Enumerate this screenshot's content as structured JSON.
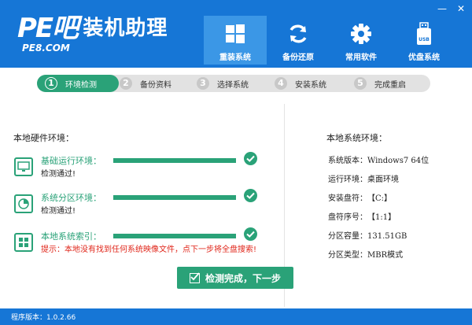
{
  "header": {
    "logo_mark": "PE吧",
    "logo_title": "装机助理",
    "logo_site": "PE8.COM",
    "window_controls": [
      "—",
      "✕"
    ],
    "nav": [
      {
        "label": "重装系统",
        "icon": "windows-icon",
        "active": true
      },
      {
        "label": "备份还原",
        "icon": "refresh-icon",
        "active": false
      },
      {
        "label": "常用软件",
        "icon": "gear-icon",
        "active": false
      },
      {
        "label": "优盘系统",
        "icon": "usb-drive-icon",
        "active": false
      },
      {
        "label": "USB",
        "icon": "usb-text",
        "active": false
      }
    ]
  },
  "steps": [
    {
      "num": "1",
      "label": "环境检测",
      "active": true
    },
    {
      "num": "2",
      "label": "备份资料",
      "active": false
    },
    {
      "num": "3",
      "label": "选择系统",
      "active": false
    },
    {
      "num": "4",
      "label": "安装系统",
      "active": false
    },
    {
      "num": "5",
      "label": "完成重启",
      "active": false
    }
  ],
  "hardware": {
    "title": "本地硬件环境：",
    "checks": [
      {
        "name": "基础运行环境：",
        "status": "检测通过!",
        "warn": false,
        "progress": 1.0,
        "icon": "monitor-icon"
      },
      {
        "name": "系统分区环境：",
        "status": "检测通过!",
        "warn": false,
        "progress": 1.0,
        "icon": "pie-chart-icon"
      },
      {
        "name": "本地系统索引：",
        "status": "提示：本地没有找到任何系统映像文件，点下一步将全盘搜索!",
        "warn": true,
        "progress": 1.0,
        "icon": "windows-logo-icon"
      }
    ]
  },
  "system": {
    "title": "本地系统环境：",
    "rows": [
      {
        "label": "系统版本：",
        "value": "Windows7  64位"
      },
      {
        "label": "运行环境：",
        "value": "桌面环境"
      },
      {
        "label": "安装盘符：",
        "value": "【C:】"
      },
      {
        "label": "盘符序号：",
        "value": "【1:1】"
      },
      {
        "label": "分区容量：",
        "value": "131.51GB"
      },
      {
        "label": "分区类型：",
        "value": "MBR模式"
      }
    ]
  },
  "next_button": {
    "label": "检测完成，下一步"
  },
  "footer": {
    "version": "程序版本：1.0.2.66"
  },
  "colors": {
    "header_blue": "#1676d6",
    "accent_green": "#2aa278",
    "warn_red": "#e0261a"
  }
}
